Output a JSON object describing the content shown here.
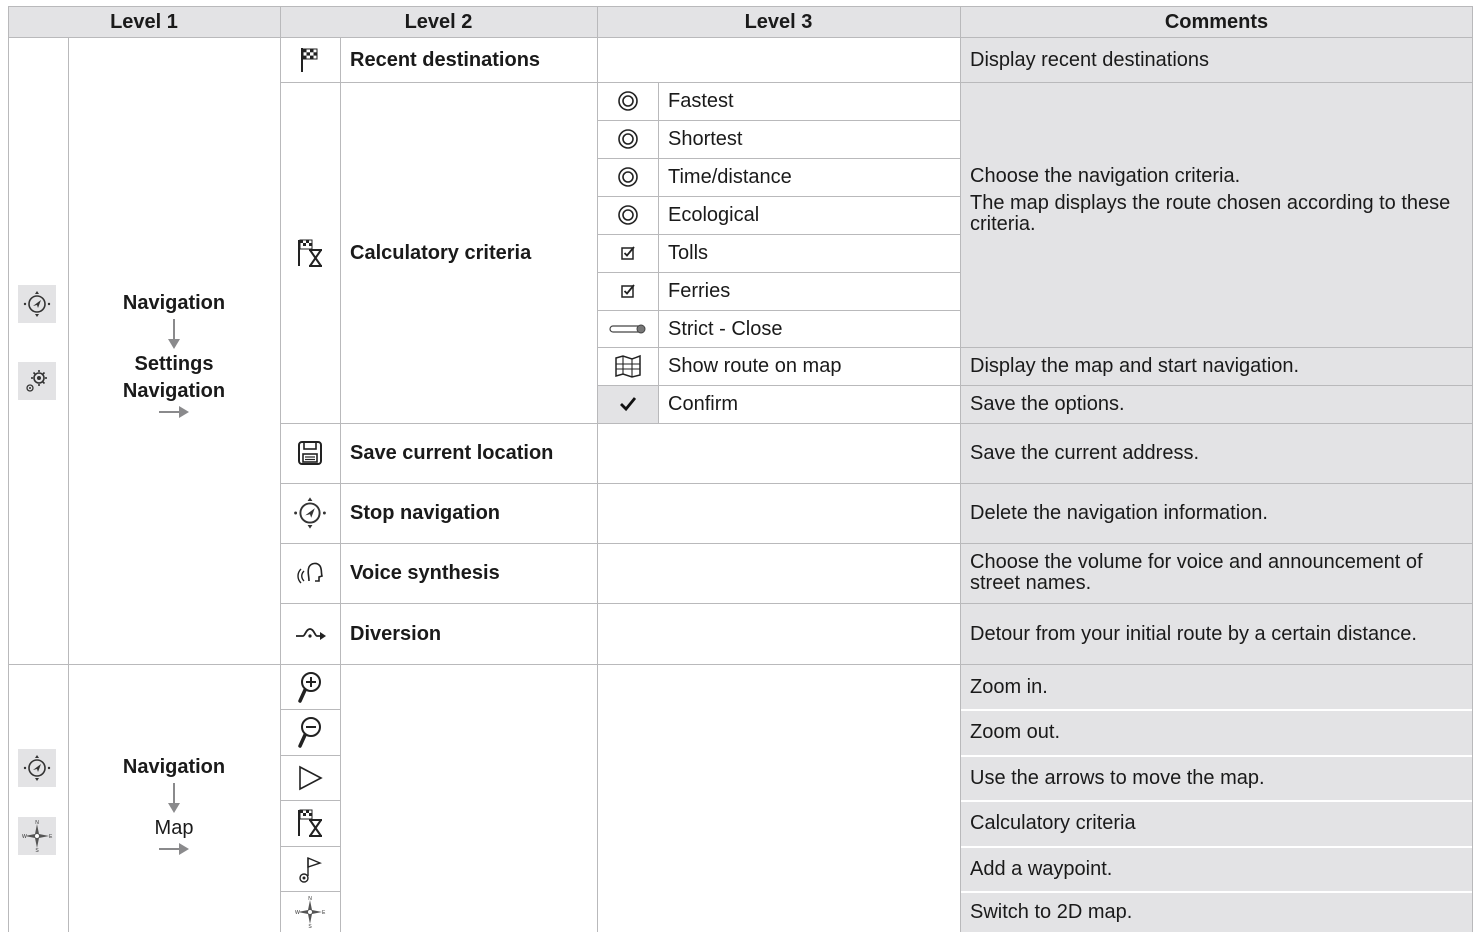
{
  "header": {
    "level1": "Level 1",
    "level2": "Level 2",
    "level3": "Level 3",
    "comments": "Comments"
  },
  "section_navigation": {
    "nav_label": "Navigation",
    "settings_label": "Settings",
    "settings_nav_label": "Navigation",
    "level1_icons": [
      "navigation-compass-icon",
      "settings-gear-icon"
    ],
    "items": [
      {
        "icon": "checkered-flag-icon",
        "label": "Recent destinations",
        "comment": "Display recent destinations"
      },
      {
        "icon": "flag-hourglass-icon",
        "label": "Calculatory criteria",
        "comment_line1": "Choose the navigation criteria.",
        "comment_line2": "The map displays the route chosen according to these criteria."
      },
      {
        "icon": "floppy-disk-icon",
        "label": "Save current location",
        "comment": "Save the current address."
      },
      {
        "icon": "navigation-compass-icon",
        "label": "Stop navigation",
        "comment": "Delete the navigation information."
      },
      {
        "icon": "voice-head-icon",
        "label": "Voice synthesis",
        "comment": "Choose the volume for voice and announcement of street names."
      },
      {
        "icon": "diversion-icon",
        "label": "Diversion",
        "comment": "Detour from your initial route by a certain distance."
      }
    ],
    "criteria_options": [
      {
        "icon": "radio-icon",
        "label": "Fastest"
      },
      {
        "icon": "radio-icon",
        "label": "Shortest"
      },
      {
        "icon": "radio-icon",
        "label": "Time/distance"
      },
      {
        "icon": "radio-icon",
        "label": "Ecological"
      },
      {
        "icon": "checkbox-icon",
        "label": "Tolls"
      },
      {
        "icon": "checkbox-icon",
        "label": "Ferries"
      },
      {
        "icon": "slider-icon",
        "label": "Strict - Close"
      },
      {
        "icon": "map-icon",
        "label": "Show route on map",
        "comment": "Display the map and start navigation."
      },
      {
        "icon": "checkmark-icon",
        "label": "Confirm",
        "comment": "Save the options."
      }
    ]
  },
  "section_map": {
    "nav_label": "Navigation",
    "map_label": "Map",
    "level1_icons": [
      "navigation-compass-icon",
      "compass-rose-icon"
    ],
    "items": [
      {
        "icon": "zoom-in-icon",
        "comment": "Zoom in."
      },
      {
        "icon": "zoom-out-icon",
        "comment": "Zoom out."
      },
      {
        "icon": "play-arrow-icon",
        "comment": "Use the arrows to move the map."
      },
      {
        "icon": "flag-hourglass-icon",
        "comment": "Calculatory criteria"
      },
      {
        "icon": "waypoint-flag-icon",
        "comment": "Add a waypoint."
      },
      {
        "icon": "compass-rose-icon",
        "comment": "Switch to 2D map."
      }
    ]
  },
  "colors": {
    "header_bg": "#e3e3e5",
    "comment_bg": "#e3e3e5",
    "grid_line": "#b9b9bb",
    "text": "#1a1a1a"
  }
}
